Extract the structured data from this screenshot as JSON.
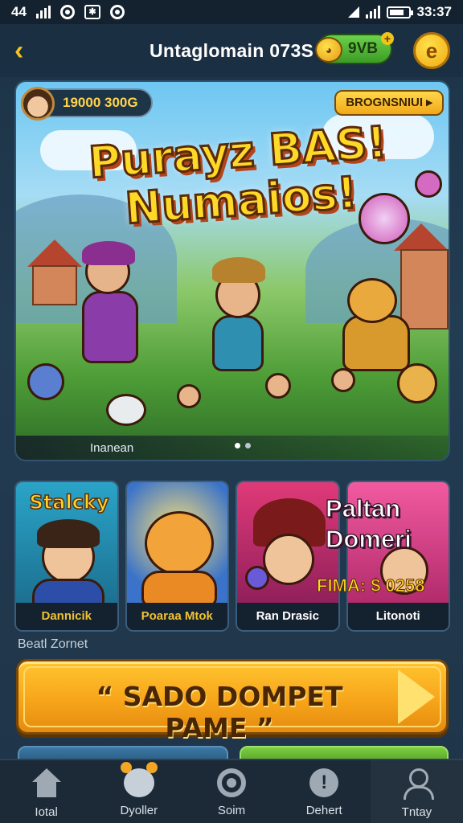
{
  "status_bar": {
    "left_text": "44",
    "time": "33:37"
  },
  "header": {
    "title": "Untaglomain 073S",
    "coin_value": "9VB",
    "back_icon": "chevron-left-icon",
    "profile_icon": "coin-e-icon"
  },
  "hero": {
    "balance": "19000 300G",
    "promo_button": "BROGNSNIUI",
    "title_line1": "Purayz BAS!",
    "title_line2": "Numaios!",
    "caption": "Inanean"
  },
  "cards": [
    {
      "overlay": "Stalcky",
      "label": "Dannicik"
    },
    {
      "overlay": "",
      "label": "Poaraa Mtok"
    },
    {
      "overlay": "",
      "label": "Ran Drasic"
    },
    {
      "overlay": "",
      "label": "Litonoti"
    }
  ],
  "promo_card": {
    "title_line1": "Paltan",
    "title_line2": "Domeri",
    "price": "FIMA: $ 0258"
  },
  "section": {
    "label": "Beatl Zornet"
  },
  "cta": {
    "label": "“ SADO DOMPET PAME ”"
  },
  "bottom_nav": [
    {
      "label": "Iotal",
      "icon": "home-icon"
    },
    {
      "label": "Dyoller",
      "icon": "friends-icon"
    },
    {
      "label": "Soim",
      "icon": "settings-icon"
    },
    {
      "label": "Dehert",
      "icon": "alert-icon"
    },
    {
      "label": "Tntay",
      "icon": "profile-icon"
    }
  ],
  "colors": {
    "accent": "#f6c31c",
    "background": "#1d3346",
    "cta": "#f7a51a",
    "coin_pill": "#4fae31"
  }
}
